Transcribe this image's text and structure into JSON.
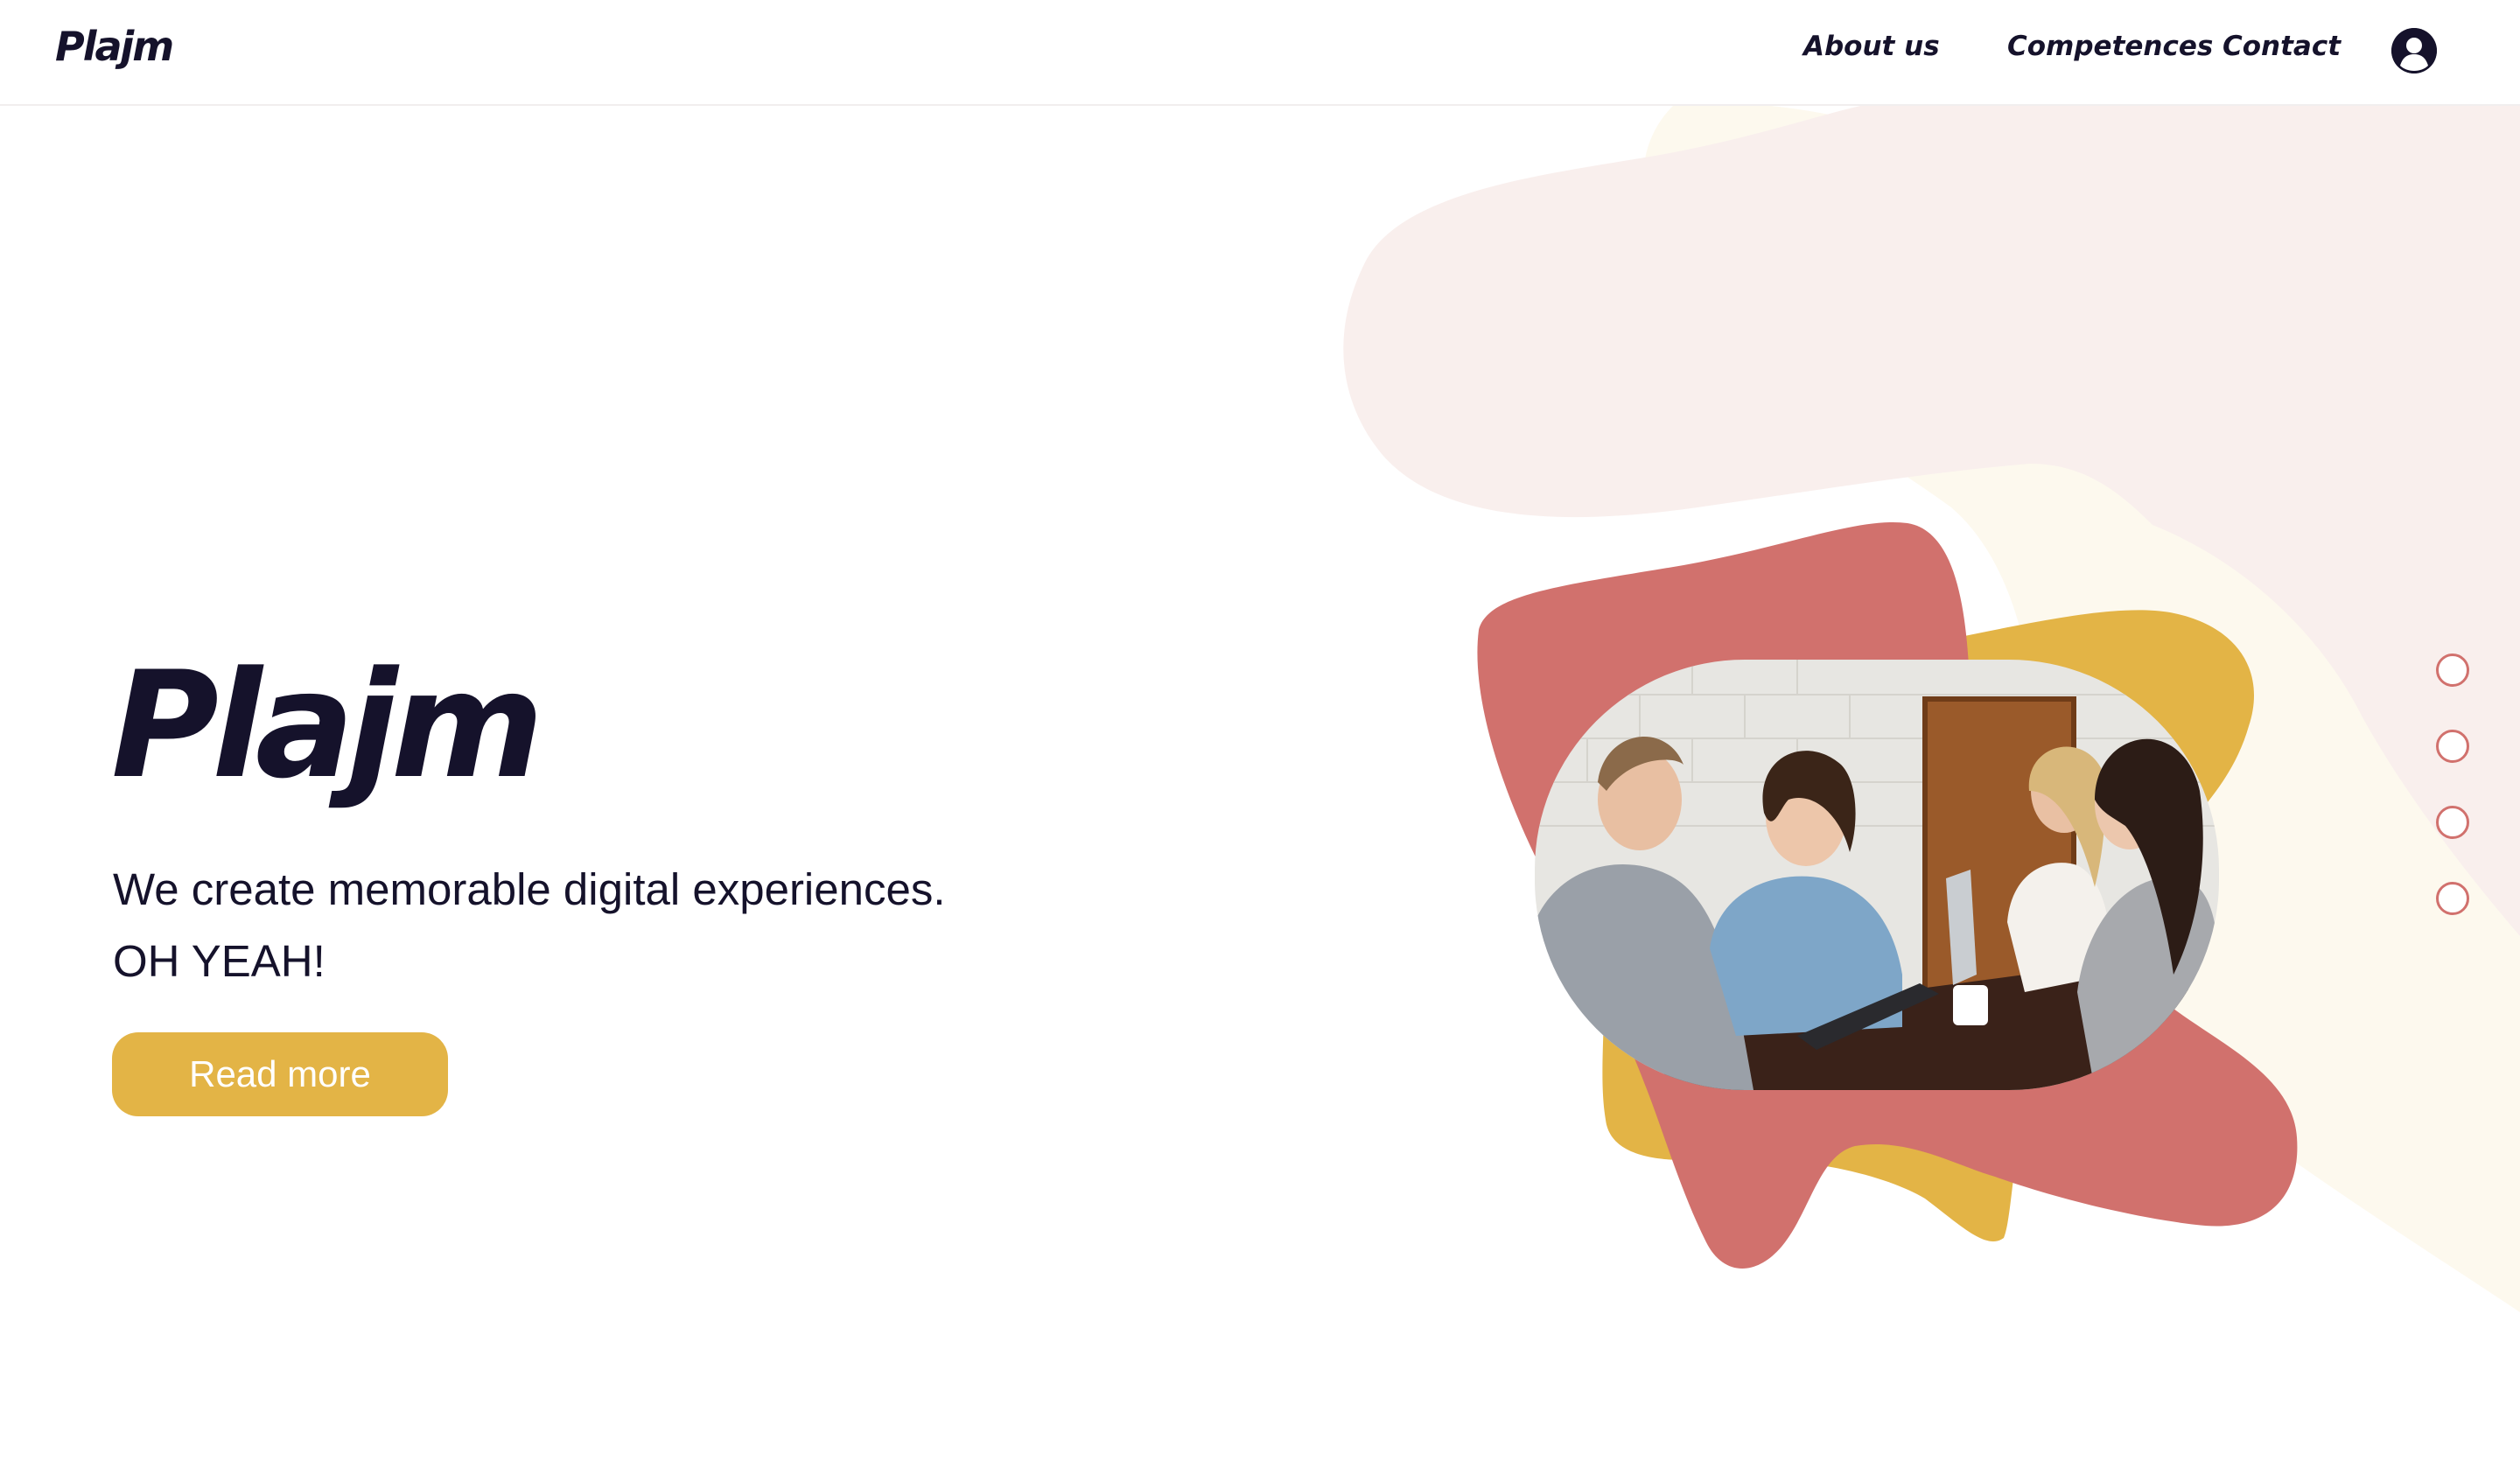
{
  "header": {
    "brand": "Plajm",
    "nav": [
      {
        "label": "About us"
      },
      {
        "label": "Competences"
      },
      {
        "label": "Contact"
      }
    ],
    "account_icon": "user-circle-icon"
  },
  "hero": {
    "title": "Plajm",
    "subtitle_line_1": "We create memorable digital experiences.",
    "subtitle_line_2": "OH YEAH!",
    "cta_label": "Read more",
    "image_alt": "Four people smiling and working together at a table with a laptop and tablet"
  },
  "carousel": {
    "slide_count": 4,
    "active_slide": null
  },
  "colors": {
    "ink": "#15122b",
    "accent_yellow": "#e3b446",
    "accent_coral": "#d1716d",
    "blush": "#f9efed",
    "cream": "#fdf9ee"
  }
}
